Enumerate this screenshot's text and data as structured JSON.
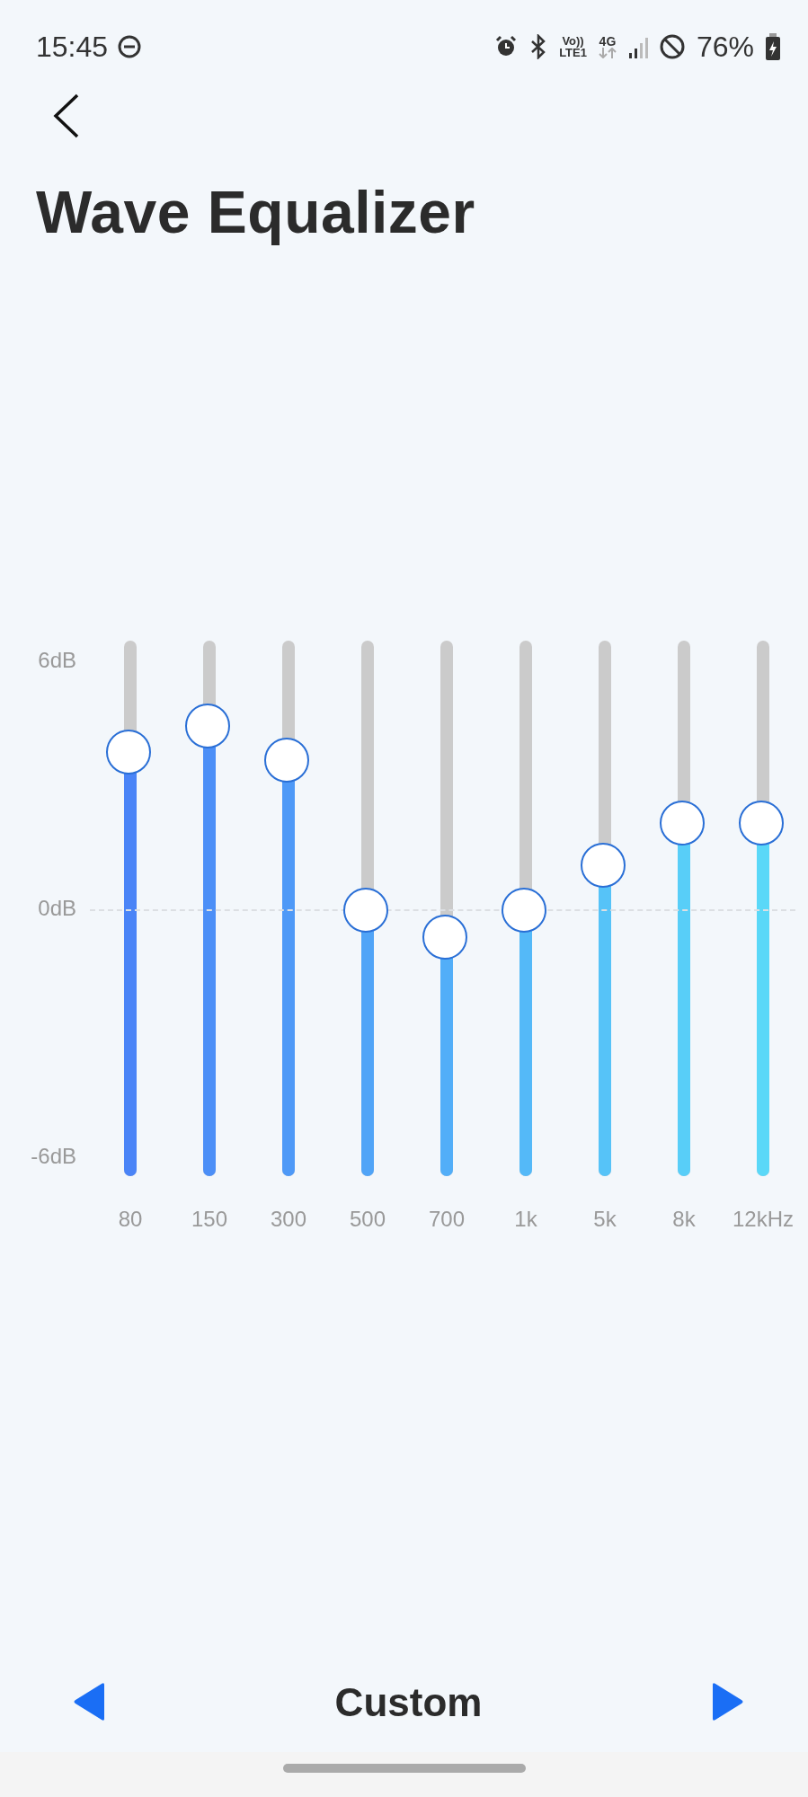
{
  "status_bar": {
    "time": "15:45",
    "volte_top": "Vo))",
    "volte_bottom": "LTE1",
    "network": "4G",
    "battery": "76%"
  },
  "title": "Wave Equalizer",
  "scale_labels": [
    "6dB",
    "0dB",
    "-6dB"
  ],
  "bands": [
    {
      "label": "80",
      "level": 0.795
    },
    {
      "label": "150",
      "level": 0.844
    },
    {
      "label": "300",
      "level": 0.78
    },
    {
      "label": "500",
      "level": 0.5
    },
    {
      "label": "700",
      "level": 0.45
    },
    {
      "label": "1k",
      "level": 0.5
    },
    {
      "label": "5k",
      "level": 0.584
    },
    {
      "label": "8k",
      "level": 0.663
    },
    {
      "label": "12kHz",
      "level": 0.663
    }
  ],
  "preset": {
    "name": "Custom"
  }
}
